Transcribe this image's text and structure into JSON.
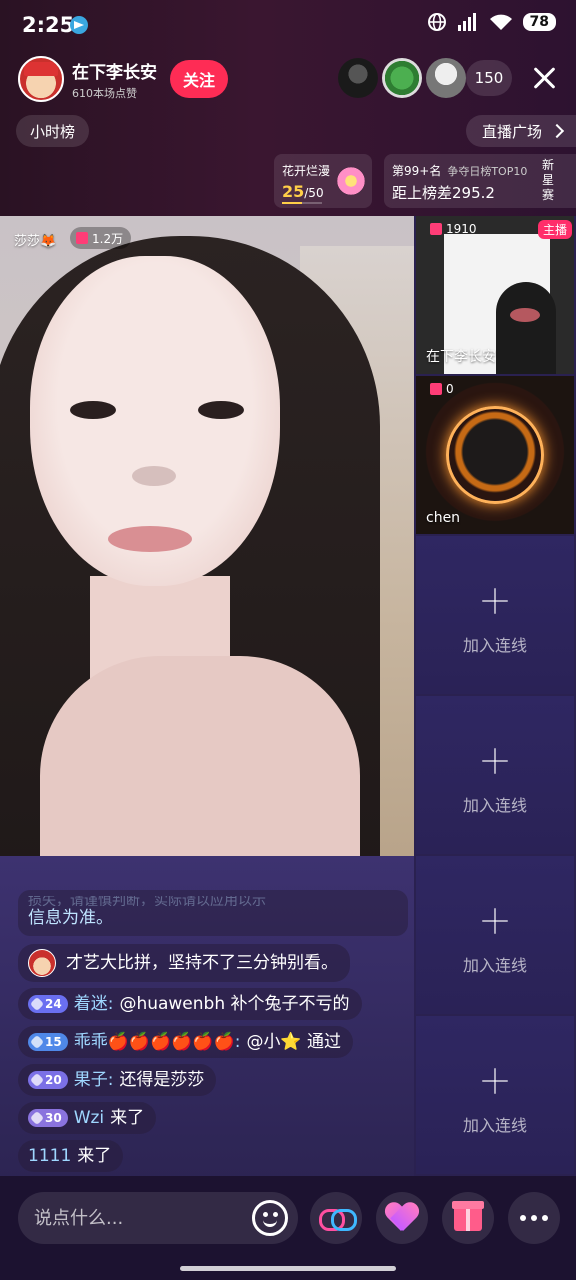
{
  "status_bar": {
    "time": "2:25",
    "battery": "78"
  },
  "header": {
    "host_name": "在下李长安",
    "host_likes": "610本场点赞",
    "follow_label": "关注",
    "viewer_count": "150"
  },
  "nav": {
    "hour_rank": "小时榜",
    "live_plaza": "直播广场"
  },
  "flower_task": {
    "title": "花开烂漫",
    "current": "25",
    "total": "/50",
    "progress": 0.5
  },
  "rank_card": {
    "rank": "第99+名",
    "board": "争夺日榜TOP10",
    "gap": "距上榜差295.2",
    "side": "新星赛"
  },
  "streamer": {
    "name": "莎莎🦊",
    "score": "1.2万"
  },
  "comments": {
    "notice_faded": "损失，请谨慎判断，实际请以应用以示",
    "notice": "信息为准。",
    "host_msg": "才艺大比拼，坚持不了三分钟别看。",
    "items": [
      {
        "level": "24",
        "user": "着迷:",
        "text": "@huawenbh 补个兔子不亏的"
      },
      {
        "level": "15",
        "user": "乖乖🍎🍎🍎🍎🍎🍎:",
        "text": "@小⭐ 通过"
      },
      {
        "level": "20",
        "user": "果子:",
        "text": "还得是莎莎"
      },
      {
        "level": "30",
        "user": "Wzi",
        "text": "来了"
      },
      {
        "user": "1111",
        "text": "来了"
      }
    ]
  },
  "side_panel": {
    "host_cell": {
      "count": "1910",
      "badge": "主播",
      "name": "在下李长安"
    },
    "guest_cell": {
      "count": "0",
      "name": "chen"
    },
    "join_label": "加入连线"
  },
  "bottom_bar": {
    "placeholder": "说点什么..."
  },
  "colors": {
    "accent": "#fe2c55",
    "progress": "#ffcf48",
    "user_name": "#9fd7ff"
  }
}
